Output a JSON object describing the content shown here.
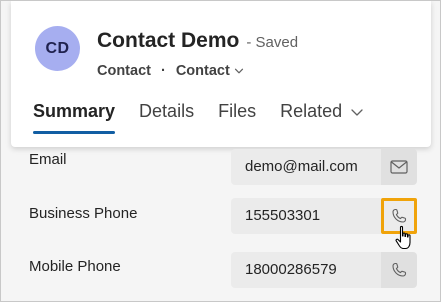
{
  "header": {
    "avatar_initials": "CD",
    "title": "Contact Demo",
    "save_status": "- Saved",
    "entity_type": "Contact",
    "separator": "·",
    "form_name": "Contact"
  },
  "tabs": [
    {
      "label": "Summary",
      "active": true
    },
    {
      "label": "Details",
      "active": false
    },
    {
      "label": "Files",
      "active": false
    },
    {
      "label": "Related",
      "active": false
    }
  ],
  "fields": [
    {
      "label": "Email",
      "value": "demo@mail.com",
      "action_icon": "mail-icon"
    },
    {
      "label": "Business Phone",
      "value": "155503301",
      "action_icon": "phone-icon"
    },
    {
      "label": "Mobile Phone",
      "value": "18000286579",
      "action_icon": "phone-icon"
    }
  ],
  "colors": {
    "avatar_bg": "#a6aef0",
    "tab_underline": "#115ea3",
    "highlight_border": "#f0a30a",
    "input_bg": "#ebebeb"
  }
}
